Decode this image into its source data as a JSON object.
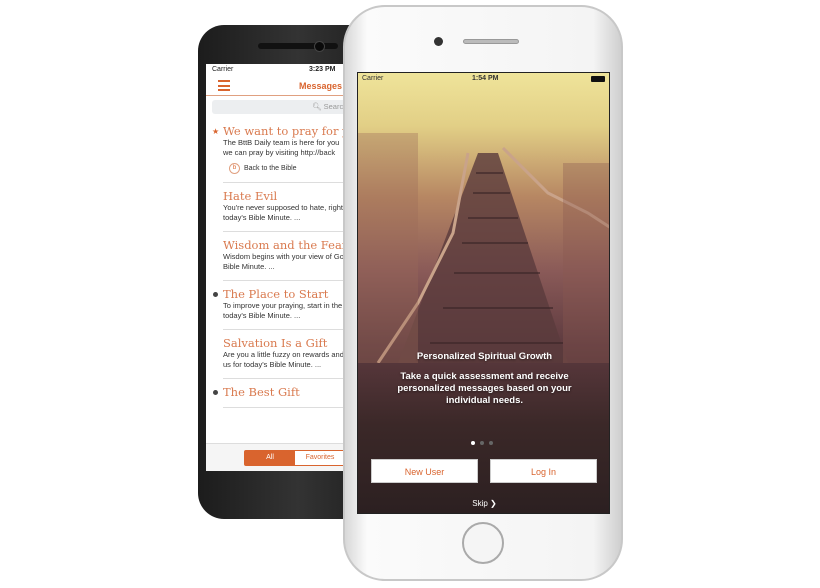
{
  "android": {
    "status": {
      "carrier": "Carrier",
      "time": "3:23 PM"
    },
    "nav_title": "Messages",
    "search_placeholder": "Search",
    "messages": [
      {
        "title": "We want to pray for you",
        "body1": "The BttB Daily team is here for you",
        "body2": "we can pray by visiting http://back",
        "marker": "star",
        "source": "Back to the Bible"
      },
      {
        "title": "Hate Evil",
        "body1": "You're never supposed to hate, right?",
        "body2": "today's Bible Minute. ...",
        "marker": "none"
      },
      {
        "title": "Wisdom and the Fear",
        "body1": "Wisdom begins with your view of God",
        "body2": "Bible Minute. ...",
        "marker": "none"
      },
      {
        "title": "The Place to Start",
        "body1": "To improve your praying, start in the",
        "body2": "today's Bible Minute. ...",
        "marker": "dot"
      },
      {
        "title": "Salvation Is a Gift",
        "body1": "Are you a little fuzzy on rewards and",
        "body2": "us for today's Bible Minute. ...",
        "marker": "none"
      },
      {
        "title": "The Best Gift",
        "body1": "",
        "body2": "",
        "marker": "dot"
      }
    ],
    "tabs": [
      {
        "label": "All",
        "selected": true
      },
      {
        "label": "Favorites",
        "selected": false
      }
    ]
  },
  "iphone": {
    "status": {
      "carrier": "Carrier",
      "time": "1:54 PM"
    },
    "heading": "Personalized Spiritual Growth",
    "description": "Take a quick assessment and receive personalized messages based on your individual needs.",
    "page_indicator": {
      "current": 1,
      "total": 3
    },
    "new_user_label": "New User",
    "login_label": "Log In",
    "skip_label": "Skip"
  },
  "colors": {
    "accent": "#d9642e",
    "title": "#d97a4f"
  }
}
